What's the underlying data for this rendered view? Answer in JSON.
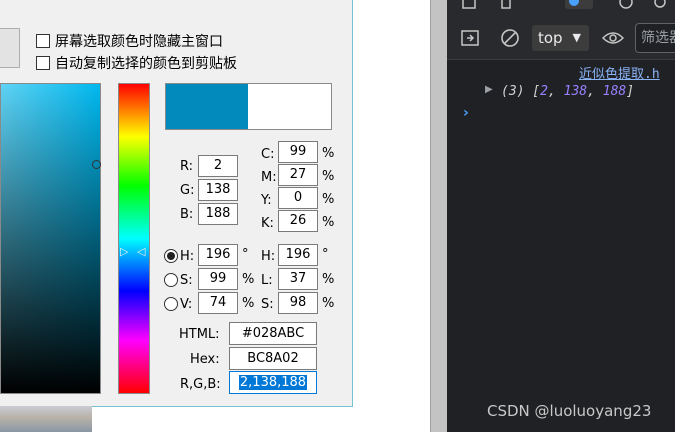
{
  "picker": {
    "options": [
      {
        "label": "屏幕选取颜色时隐藏主窗口",
        "checked": false
      },
      {
        "label": "自动复制选择的颜色到剪贴板",
        "checked": false
      }
    ],
    "color_hex": "#028ABC",
    "previous_color_hex": "#FFFFFF",
    "rgb": {
      "R": "2",
      "G": "138",
      "B": "188"
    },
    "cmyk": {
      "C": "99",
      "M": "27",
      "Y": "0",
      "K": "26",
      "unit": "%"
    },
    "hsv": {
      "H": "196",
      "S": "99",
      "V": "74",
      "selected": "H",
      "deg": "°",
      "pct": "%"
    },
    "hls": {
      "H": "196",
      "L": "37",
      "S": "98",
      "deg": "°",
      "pct": "%"
    },
    "labels": {
      "R": "R:",
      "G": "G:",
      "B": "B:",
      "C": "C:",
      "M": "M:",
      "Y": "Y:",
      "K": "K:",
      "H": "H:",
      "S": "S:",
      "V": "V:",
      "L": "L:",
      "HTML": "HTML:",
      "Hex": "Hex:",
      "RGB": "R,G,B:"
    },
    "html": "#028ABC",
    "hex": "BC8A02",
    "rgb_csv": "2,138,188",
    "hue_arrows": [
      "▷",
      "◁"
    ]
  },
  "devtools": {
    "context": "top",
    "filter_placeholder": "筛选器",
    "source_link": "近似色提取.h",
    "log": {
      "prefix": "(3) [",
      "values": [
        "2",
        "138",
        "188"
      ],
      "sep": ", ",
      "suffix": "]"
    },
    "log_caret": "▶",
    "prompt": "›",
    "watermark": "CSDN @luoluoyang23"
  },
  "colors": {
    "accent": "#028ABC",
    "devtools_bg": "#202124",
    "link": "#8ab4f8",
    "number": "#9980ff"
  }
}
